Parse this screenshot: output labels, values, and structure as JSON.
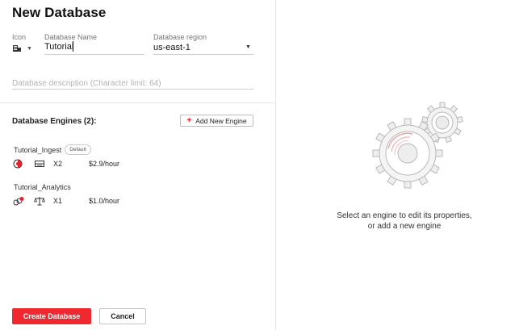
{
  "form": {
    "title": "New Database",
    "icon_label": "Icon",
    "name_label": "Database Name",
    "name_value": "Tutorial",
    "region_label": "Database region",
    "region_value": "us-east-1",
    "description_placeholder": "Database description (Character limit: 64)"
  },
  "engines": {
    "heading": "Database Engines (2):",
    "add_button_label": "Add New Engine",
    "items": [
      {
        "name": "Tutorial_Ingest",
        "badge": "Default",
        "scale": "X2",
        "price": "$2.9/hour"
      },
      {
        "name": "Tutorial_Analytics",
        "scale": "X1",
        "price": "$1.0/hour"
      }
    ]
  },
  "footer": {
    "create_label": "Create Database",
    "cancel_label": "Cancel"
  },
  "empty_state": {
    "line1": "Select an engine to edit its properties,",
    "line2": "or add a new engine"
  },
  "colors": {
    "accent": "#f0282f",
    "border": "#e6e6e6"
  }
}
